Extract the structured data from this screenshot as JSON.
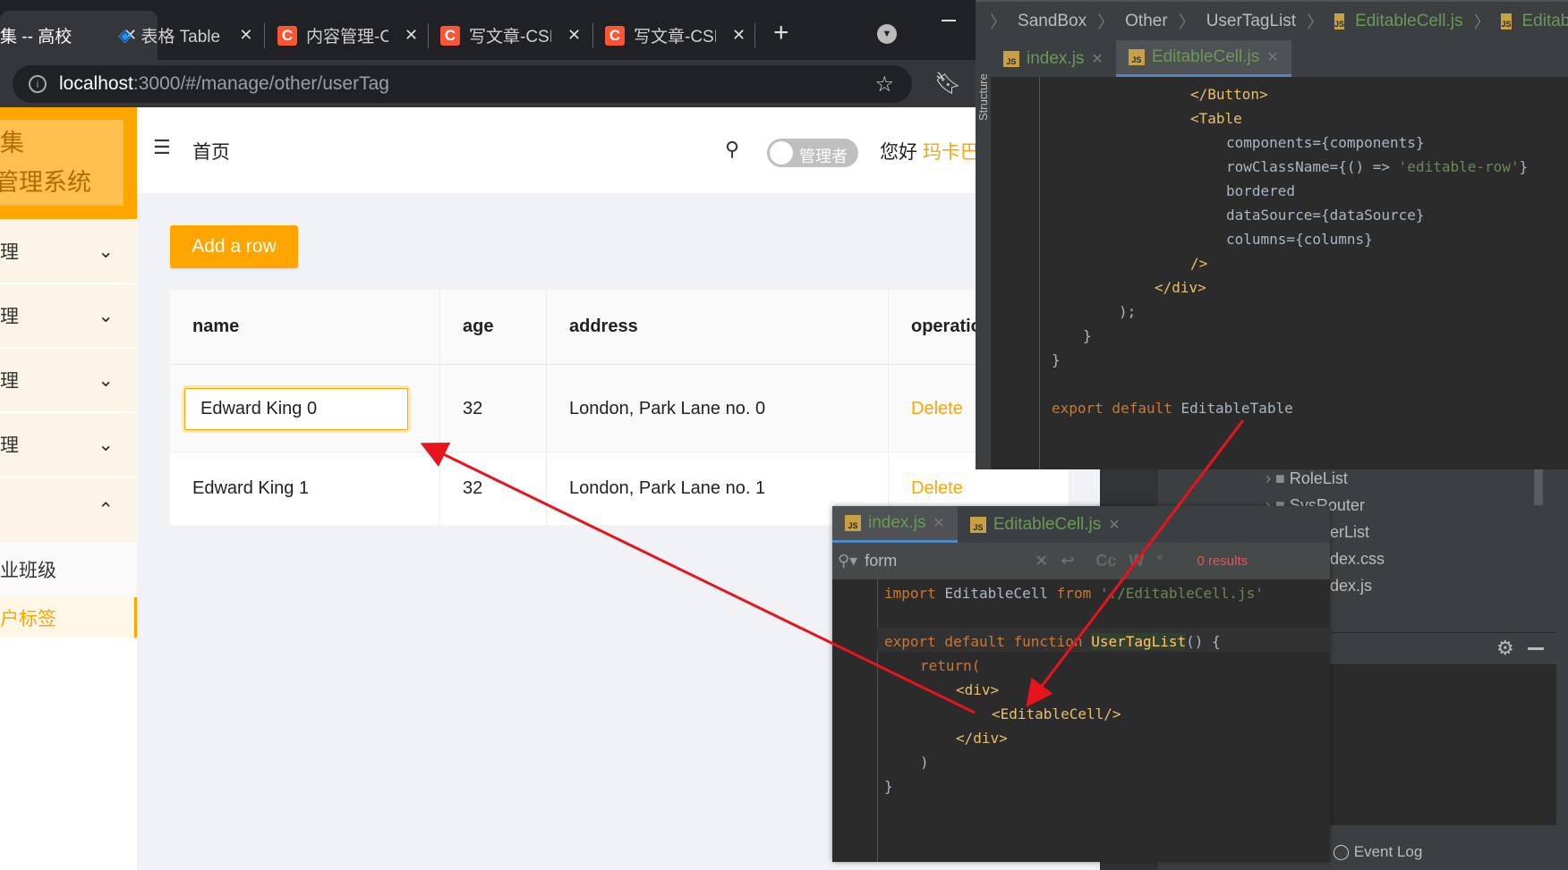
{
  "browser": {
    "tabs": [
      {
        "title": "集 -- 高校",
        "active": true
      },
      {
        "title": "表格 Table",
        "icon": "antd-logo-icon"
      },
      {
        "title": "内容管理-C",
        "icon": "csdn-icon"
      },
      {
        "title": "写文章-CSD",
        "icon": "csdn-icon"
      },
      {
        "title": "写文章-CSD",
        "icon": "csdn-icon"
      }
    ],
    "new_tab": "+",
    "url_host": "localhost",
    "url_rest": ":3000/#/manage/other/userTag"
  },
  "app": {
    "logo_line1": "集",
    "logo_line2": "管理系统",
    "breadcrumb": "首页",
    "role_toggle": "管理者",
    "greeting": "您好",
    "username": "玛卡巴",
    "menu": [
      {
        "label": "理"
      },
      {
        "label": "理"
      },
      {
        "label": "理"
      },
      {
        "label": "理"
      },
      {
        "label": ""
      }
    ],
    "submenu": [
      {
        "label": "业班级"
      },
      {
        "label": "户标签",
        "selected": true
      }
    ],
    "add_button": "Add a row",
    "columns": [
      "name",
      "age",
      "address",
      "operation"
    ],
    "rows": [
      {
        "name": "Edward King 0",
        "age": "32",
        "address": "London, Park Lane no. 0",
        "op": "Delete",
        "editing": true
      },
      {
        "name": "Edward King 1",
        "age": "32",
        "address": "London, Park Lane no. 1",
        "op": "Delete"
      }
    ],
    "accent": "#ffa500"
  },
  "ide_top": {
    "breadcrumb": [
      "SandBox",
      "Other",
      "UserTagList",
      "EditableCell.js",
      "EditableTable"
    ],
    "structure_label": "Structure",
    "tabs": [
      {
        "label": "index.js"
      },
      {
        "label": "EditableCell.js",
        "selected": true
      }
    ],
    "code": {
      "l1": "</Button>",
      "l2": "<Table",
      "l3a": "components=",
      "l3b": "{components}",
      "l4a": "rowClassName=",
      "l4b": "{() => ",
      "l4c": "'editable-row'",
      "l4d": "}",
      "l5": "bordered",
      "l6a": "dataSource=",
      "l6b": "{dataSource}",
      "l7a": "columns=",
      "l7b": "{columns}",
      "l8": "/>",
      "l9": "</div>",
      "l10": ");",
      "l11": "}",
      "l12": "}",
      "l13a": "export default ",
      "l13b": "EditableTable"
    }
  },
  "project_tree": {
    "items": [
      "RoleList",
      "SysRouter",
      "erList",
      "dex.css",
      "dex.js"
    ],
    "event_log": "Event Log"
  },
  "ide_bottom": {
    "tabs": [
      {
        "label": "index.js",
        "selected": true
      },
      {
        "label": "EditableCell.js"
      }
    ],
    "search_value": "form",
    "search_options": [
      "Cc",
      "W",
      "*"
    ],
    "results": "0 results",
    "code": {
      "l1a": "import ",
      "l1b": "EditableCell ",
      "l1c": "from ",
      "l1d": "'./EditableCell.js'",
      "l2a": "export default function ",
      "l2b": "UserTagList",
      "l2c": "() {",
      "l3": "return(",
      "l4": "<div>",
      "l5": "<EditableCell/>",
      "l6": "</div>",
      "l7": ")",
      "l8": "}"
    }
  },
  "annotation_color": "#e8141c"
}
